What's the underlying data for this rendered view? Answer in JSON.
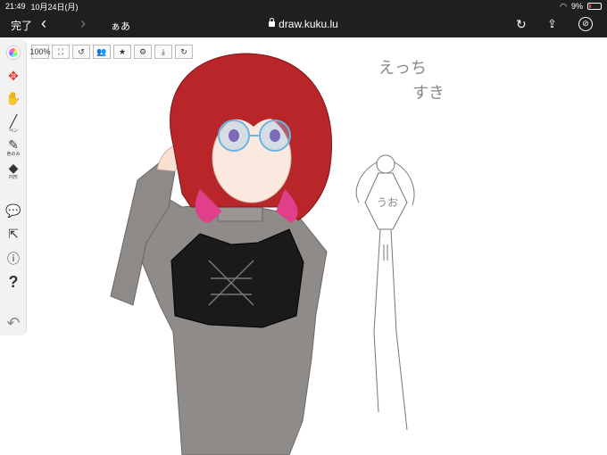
{
  "status_bar": {
    "time": "21:49",
    "date": "10月24日(月)",
    "battery": "9%"
  },
  "browser": {
    "done_label": "完了",
    "back_icon": "‹",
    "forward_icon": "›",
    "reader_label": "ぁあ",
    "url": "draw.kuku.lu",
    "reload_icon": "↻",
    "share_icon": "⇪",
    "compass_icon": "⊘"
  },
  "tools": {
    "move_icon": "✥",
    "hand_icon": "✋",
    "pen_label": "ペン",
    "eyedropper_label": "色のみ",
    "shape_label": "円形",
    "chat_icon": "💬",
    "exit_icon": "⇱",
    "info_icon": "ⓘ",
    "help_icon": "?",
    "undo_icon": "↶"
  },
  "canvas_toolbar": {
    "zoom_label": "100%",
    "items": [
      "⛶",
      "↺",
      "👥",
      "★",
      "⚙",
      "⤓",
      "↻"
    ]
  },
  "handwriting": {
    "line1": "えっち",
    "line2": "すき",
    "figure_word": "うお"
  },
  "colors": {
    "hair": "#b8262a",
    "sweater": "#8e8a88",
    "top": "#1a1a1a",
    "skin": "#fbe9df",
    "glasses": "#6fb4e0"
  }
}
